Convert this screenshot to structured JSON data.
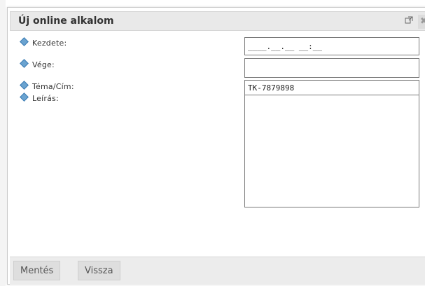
{
  "dialog": {
    "title": "Új online alkalom",
    "popout_icon": "popout-icon",
    "close_icon": "close-icon",
    "close_glyph": "✖"
  },
  "form": {
    "fields": [
      {
        "label": "Kezdete:",
        "value": "____.__.__ __:__"
      },
      {
        "label": "Vége:",
        "value": ""
      },
      {
        "label": "Téma/Cím:",
        "value": "TK-7879898"
      },
      {
        "label": "Leírás:",
        "value": ""
      }
    ]
  },
  "footer": {
    "save_label": "Mentés",
    "back_label": "Vissza"
  },
  "colors": {
    "titlebar_bg": "#e9e9e9",
    "bullet": "#6aa3d0",
    "button_bg": "#dedede"
  }
}
